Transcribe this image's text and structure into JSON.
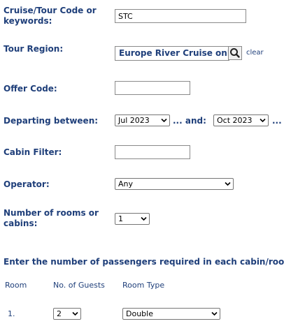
{
  "form": {
    "cruise_code": {
      "label": "Cruise/Tour Code or keywords:",
      "value": "STC"
    },
    "tour_region": {
      "label": "Tour Region:",
      "value": "Europe River Cruise only",
      "clear_label": "clear"
    },
    "offer_code": {
      "label": "Offer Code:",
      "value": ""
    },
    "departing": {
      "label": "Departing between:",
      "from": "Jul 2023",
      "and_label": "... and:",
      "to": "Oct 2023",
      "trailing": "..."
    },
    "cabin_filter": {
      "label": "Cabin Filter:",
      "value": ""
    },
    "operator": {
      "label": "Operator:",
      "value": "Any"
    },
    "rooms": {
      "label": "Number of rooms or cabins:",
      "value": "1"
    }
  },
  "passengers": {
    "title": "Enter the number of passengers required in each cabin/room:",
    "headers": {
      "room": "Room",
      "guests": "No. of Guests",
      "room_type": "Room Type"
    },
    "rows": [
      {
        "room": "1.",
        "guests": "2",
        "room_type": "Double"
      }
    ]
  },
  "icons": {
    "search": "magnifier-icon",
    "dropdown": "chevron-down-icon"
  }
}
